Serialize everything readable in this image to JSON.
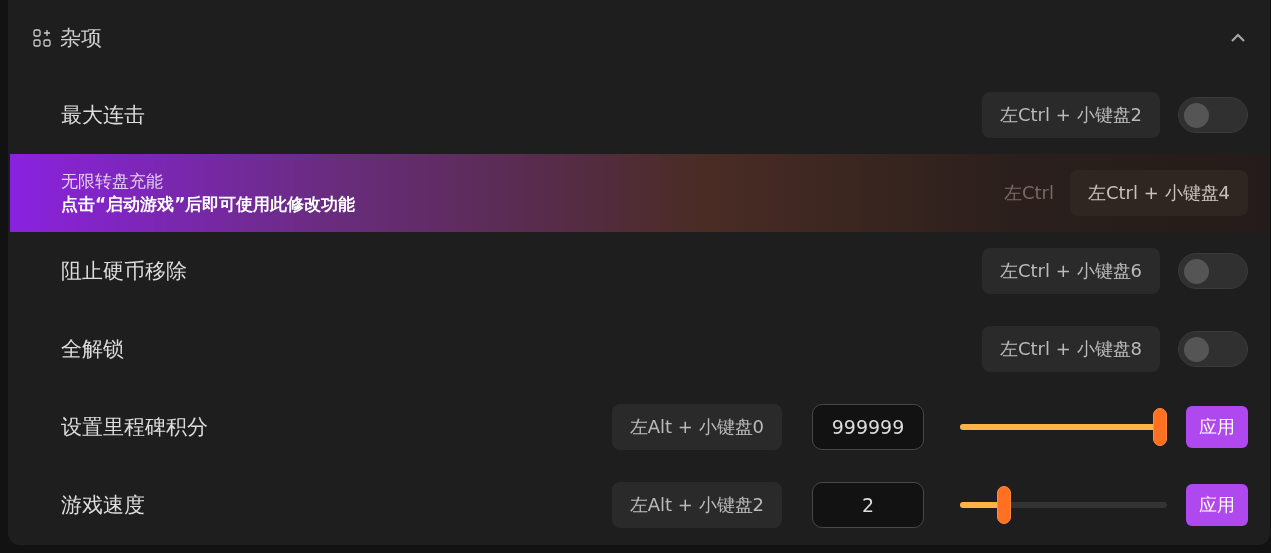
{
  "section": {
    "title": "杂项",
    "expanded": true
  },
  "rows": [
    {
      "kind": "toggle",
      "label": "最大连击",
      "hotkey": "左Ctrl + 小键盘2",
      "on": false
    },
    {
      "kind": "notice",
      "label": "无限转盘充能",
      "message": "点击“启动游戏”后即可使用此修改功能",
      "ghost_hotkey": "左Ctrl",
      "hotkey": "左Ctrl + 小键盘4"
    },
    {
      "kind": "toggle",
      "label": "阻止硬币移除",
      "hotkey": "左Ctrl + 小键盘6",
      "on": false
    },
    {
      "kind": "toggle",
      "label": "全解锁",
      "hotkey": "左Ctrl + 小键盘8",
      "on": false
    },
    {
      "kind": "slider",
      "label": "设置里程碑积分",
      "hotkey": "左Alt + 小键盘0",
      "value": "999999",
      "level": 1,
      "button": "应用"
    },
    {
      "kind": "slider",
      "label": "游戏速度",
      "hotkey": "左Alt + 小键盘2",
      "value": "2",
      "level": 0.19,
      "button": "应用"
    }
  ]
}
